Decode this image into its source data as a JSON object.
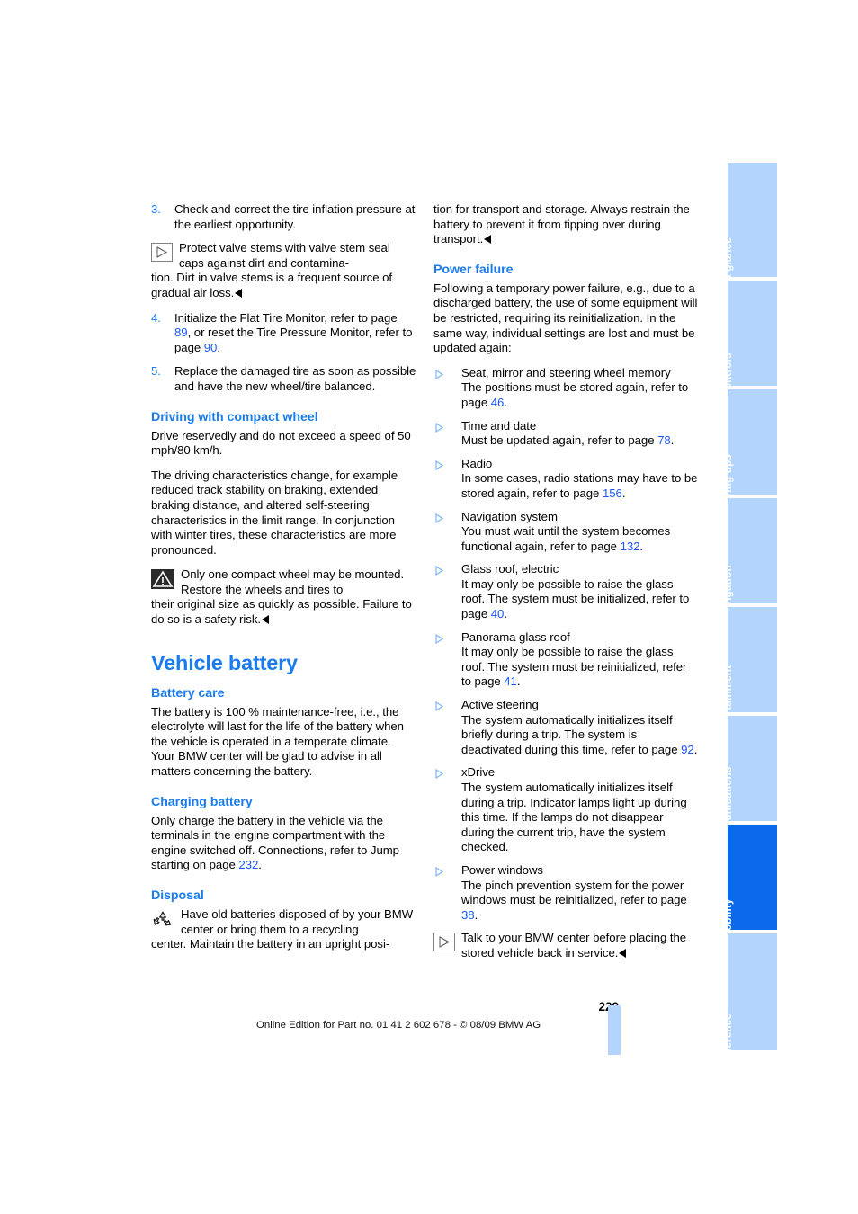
{
  "document": {
    "page_number": "229",
    "footer_text": "Online Edition for Part no. 01 41 2 602 678 - © 08/09 BMW AG"
  },
  "colors": {
    "accent_blue": "#1a7ced",
    "link_blue": "#1a55ff",
    "tab_blue": "#b3d4fc",
    "tab_active_blue": "#0a6aeb"
  },
  "sidebar": {
    "tabs": [
      {
        "label": "At a glance",
        "active": false
      },
      {
        "label": "Controls",
        "active": false
      },
      {
        "label": "Driving tips",
        "active": false
      },
      {
        "label": "Navigation",
        "active": false
      },
      {
        "label": "Entertainment",
        "active": false
      },
      {
        "label": "Communications",
        "active": false
      },
      {
        "label": "Mobility",
        "active": true
      },
      {
        "label": "Reference",
        "active": false
      }
    ]
  },
  "left_column": {
    "step3": {
      "num": "3.",
      "text": "Check and correct the tire inflation pressure at the earliest opportunity."
    },
    "note_valve": {
      "icon": "note-triangle-icon",
      "text_a": "Protect valve stems with valve stem seal caps against dirt and contamina-",
      "text_b": "tion. Dirt in valve stems is a frequent source of gradual air loss."
    },
    "step4": {
      "num": "4.",
      "part_a": "Initialize the Flat Tire Monitor, refer to page ",
      "page_a": "89",
      "part_b": ", or reset the Tire Pressure Monitor, refer to page ",
      "page_b": "90",
      "part_c": "."
    },
    "step5": {
      "num": "5.",
      "text": "Replace the damaged tire as soon as possible and have the new wheel/tire balanced."
    },
    "heading_compact": "Driving with compact wheel",
    "compact_p1": "Drive reservedly and do not exceed a speed of 50 mph/80 km/h.",
    "compact_p2": "The driving characteristics change, for example reduced track stability on braking, extended braking distance, and altered self-steering characteristics in the limit range. In conjunction with winter tires, these characteristics are more pronounced.",
    "warning_compact": {
      "icon": "warning-triangle-icon",
      "text_a": "Only one compact wheel may be mounted. Restore the wheels and tires to",
      "text_b": "their original size as quickly as possible. Failure to do so is a safety risk."
    },
    "heading_vehicle_battery": "Vehicle battery",
    "heading_battery_care": "Battery care",
    "battery_care_text": "The battery is 100 % maintenance-free, i.e., the electrolyte will last for the life of the battery when the vehicle is operated in a temperate climate. Your BMW center will be glad to advise in all matters concerning the battery.",
    "heading_charging_battery": "Charging battery",
    "charging_part_a": "Only charge the battery in the vehicle via the terminals in the engine compartment with the engine switched off. Connections, refer to Jump starting on page ",
    "charging_page": "232",
    "charging_part_b": ".",
    "heading_disposal": "Disposal",
    "disposal": {
      "icon": "recycling-icon",
      "text_a": "Have old batteries disposed of by your BMW center or bring them to a recycling",
      "text_b": "center. Maintain the battery in an upright posi-"
    }
  },
  "right_column": {
    "continuation": "tion for transport and storage. Always restrain the battery to prevent it from tipping over during transport.",
    "heading_power_failure": "Power failure",
    "power_failure_intro": "Following a temporary power failure, e.g., due to a discharged battery, the use of some equipment will be restricted, requiring its reinitialization. In the same way, individual settings are lost and must be updated again:",
    "bullets": [
      {
        "title": "Seat, mirror and steering wheel memory",
        "body_a": "The positions must be stored again, refer to page ",
        "page": "46",
        "body_b": "."
      },
      {
        "title": "Time and date",
        "body_a": "Must be updated again, refer to page ",
        "page": "78",
        "body_b": "."
      },
      {
        "title": "Radio",
        "body_a": "In some cases, radio stations may have to be stored again, refer to page ",
        "page": "156",
        "body_b": "."
      },
      {
        "title": "Navigation system",
        "body_a": "You must wait until the system becomes functional again, refer to page ",
        "page": "132",
        "body_b": "."
      },
      {
        "title": "Glass roof, electric",
        "body_a": "It may only be possible to raise the glass roof. The system must be initialized, refer to page ",
        "page": "40",
        "body_b": "."
      },
      {
        "title": "Panorama glass roof",
        "body_a": "It may only be possible to raise the glass roof. The system must be reinitialized, refer to page ",
        "page": "41",
        "body_b": "."
      },
      {
        "title": "Active steering",
        "body_a": "The system automatically initializes itself briefly during a trip. The system is deactivated during this time, refer to page ",
        "page": "92",
        "body_b": "."
      },
      {
        "title": "xDrive",
        "body_a": "The system automatically initializes itself during a trip. Indicator lamps light up during this time. If the lamps do not disappear during the current trip, have the system checked.",
        "page": "",
        "body_b": ""
      },
      {
        "title": "Power windows",
        "body_a": "The pinch prevention system for the power windows must be reinitialized, refer to page ",
        "page": "38",
        "body_b": "."
      }
    ],
    "note_service": {
      "icon": "note-triangle-icon",
      "text": "Talk to your BMW center before placing the stored vehicle back in service."
    }
  }
}
